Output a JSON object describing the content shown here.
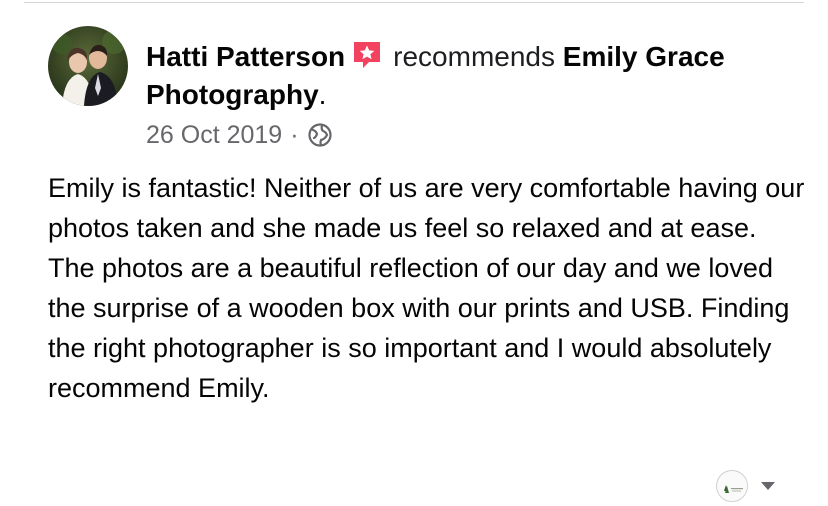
{
  "post": {
    "author": "Hatti Patterson",
    "verb": "recommends",
    "page_name": "Emily Grace Photography",
    "period": ".",
    "date": "26 Oct 2019",
    "separator": "·",
    "audience_icon": "globe-icon",
    "recommend_icon": "recommendation-star-icon",
    "body": "Emily is fantastic! Neither of us are very comfortable having our photos taken and she made us feel so relaxed and at ease. The photos are a beautiful reflection of our day and we loved the surprise of a wooden box with our prints and USB. Finding the right photographer is so important and I would absolutely recommend Emily."
  },
  "actions": {
    "page_avatar_icon": "page-avatar-icon",
    "menu_icon": "chevron-down-icon"
  },
  "colors": {
    "text_primary": "#050505",
    "text_secondary": "#65676b",
    "recommend_badge": "#f3425f"
  }
}
